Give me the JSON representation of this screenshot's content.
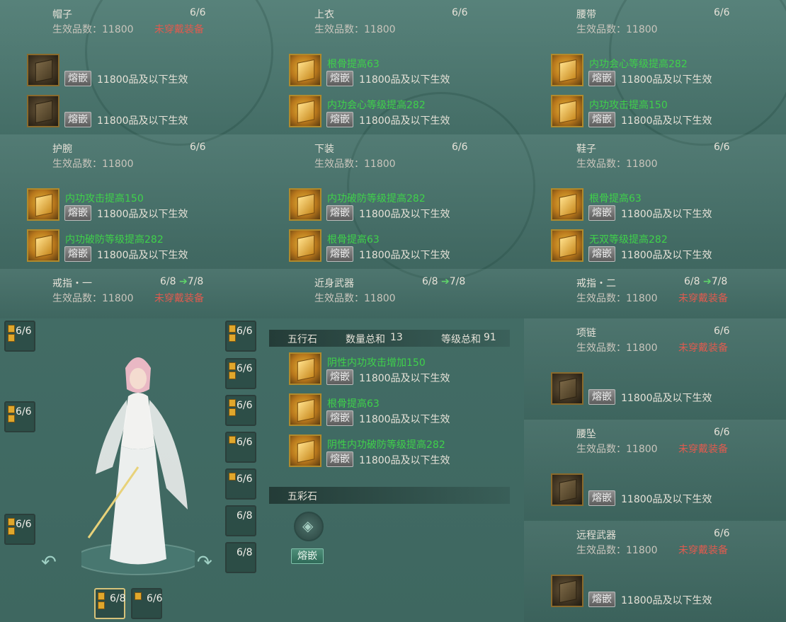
{
  "common": {
    "inlay_label": "熔嵌",
    "effect_text": "11800品及以下生效",
    "quality_text": "生效品数：11800",
    "unequipped_text": "未穿戴装备"
  },
  "slots": [
    {
      "name": "帽子",
      "progress": "6/6",
      "quality": "生效品数：11800",
      "unequipped": "未穿戴装备",
      "gems": [
        {
          "attr": "",
          "effect": "11800品及以下生效",
          "empty": true
        },
        {
          "attr": "",
          "effect": "11800品及以下生效",
          "empty": true
        }
      ]
    },
    {
      "name": "上衣",
      "progress": "6/6",
      "quality": "生效品数：11800",
      "unequipped": "",
      "gems": [
        {
          "attr": "根骨提高63",
          "effect": "11800品及以下生效"
        },
        {
          "attr": "内功会心等级提高282",
          "effect": "11800品及以下生效"
        }
      ]
    },
    {
      "name": "腰带",
      "progress": "6/6",
      "quality": "生效品数：11800",
      "unequipped": "",
      "gems": [
        {
          "attr": "内功会心等级提高282",
          "effect": "11800品及以下生效"
        },
        {
          "attr": "内功攻击提高150",
          "effect": "11800品及以下生效"
        }
      ]
    },
    {
      "name": "护腕",
      "progress": "6/6",
      "quality": "生效品数：11800",
      "unequipped": "",
      "gems": [
        {
          "attr": "内功攻击提高150",
          "effect": "11800品及以下生效"
        },
        {
          "attr": "内功破防等级提高282",
          "effect": "11800品及以下生效"
        }
      ]
    },
    {
      "name": "下装",
      "progress": "6/6",
      "quality": "生效品数：11800",
      "unequipped": "",
      "gems": [
        {
          "attr": "内功破防等级提高282",
          "effect": "11800品及以下生效"
        },
        {
          "attr": "根骨提高63",
          "effect": "11800品及以下生效"
        }
      ]
    },
    {
      "name": "鞋子",
      "progress": "6/6",
      "quality": "生效品数：11800",
      "unequipped": "",
      "gems": [
        {
          "attr": "根骨提高63",
          "effect": "11800品及以下生效"
        },
        {
          "attr": "无双等级提高282",
          "effect": "11800品及以下生效"
        }
      ]
    },
    {
      "name": "戒指・一",
      "progress": "6/8",
      "next": "7/8",
      "quality": "生效品数：11800",
      "unequipped": "未穿戴装备"
    },
    {
      "name": "近身武器",
      "progress": "6/8",
      "next": "7/8",
      "quality": "生效品数：11800",
      "unequipped": ""
    },
    {
      "name": "戒指・二",
      "progress": "6/8",
      "next": "7/8",
      "quality": "生效品数：11800",
      "unequipped": "未穿戴装备"
    }
  ],
  "right_slots": [
    {
      "name": "项链",
      "progress": "6/6",
      "quality": "生效品数：11800",
      "unequipped": "未穿戴装备",
      "effect": "11800品及以下生效"
    },
    {
      "name": "腰坠",
      "progress": "6/6",
      "quality": "生效品数：11800",
      "unequipped": "未穿戴装备",
      "effect": "11800品及以下生效"
    },
    {
      "name": "远程武器",
      "progress": "6/6",
      "quality": "生效品数：11800",
      "unequipped": "未穿戴装备",
      "effect": "11800品及以下生效"
    }
  ],
  "wuxing": {
    "title": "五行石",
    "count_label": "数量总和",
    "count_value": "13",
    "level_label": "等级总和",
    "level_value": "91",
    "gems": [
      {
        "attr": "阴性内功攻击增加150",
        "effect": "11800品及以下生效"
      },
      {
        "attr": "根骨提高63",
        "effect": "11800品及以下生效"
      },
      {
        "attr": "阴性内功破防等级提高282",
        "effect": "11800品及以下生效"
      }
    ]
  },
  "wucai": {
    "title": "五彩石",
    "button": "熔嵌"
  },
  "character_slots": {
    "left": [
      "6/6",
      "6/6",
      "6/6"
    ],
    "right": [
      "6/6",
      "6/6",
      "6/6",
      "6/6",
      "6/6",
      "6/8",
      "6/8"
    ],
    "bottom": [
      "6/8",
      "6/6"
    ]
  }
}
